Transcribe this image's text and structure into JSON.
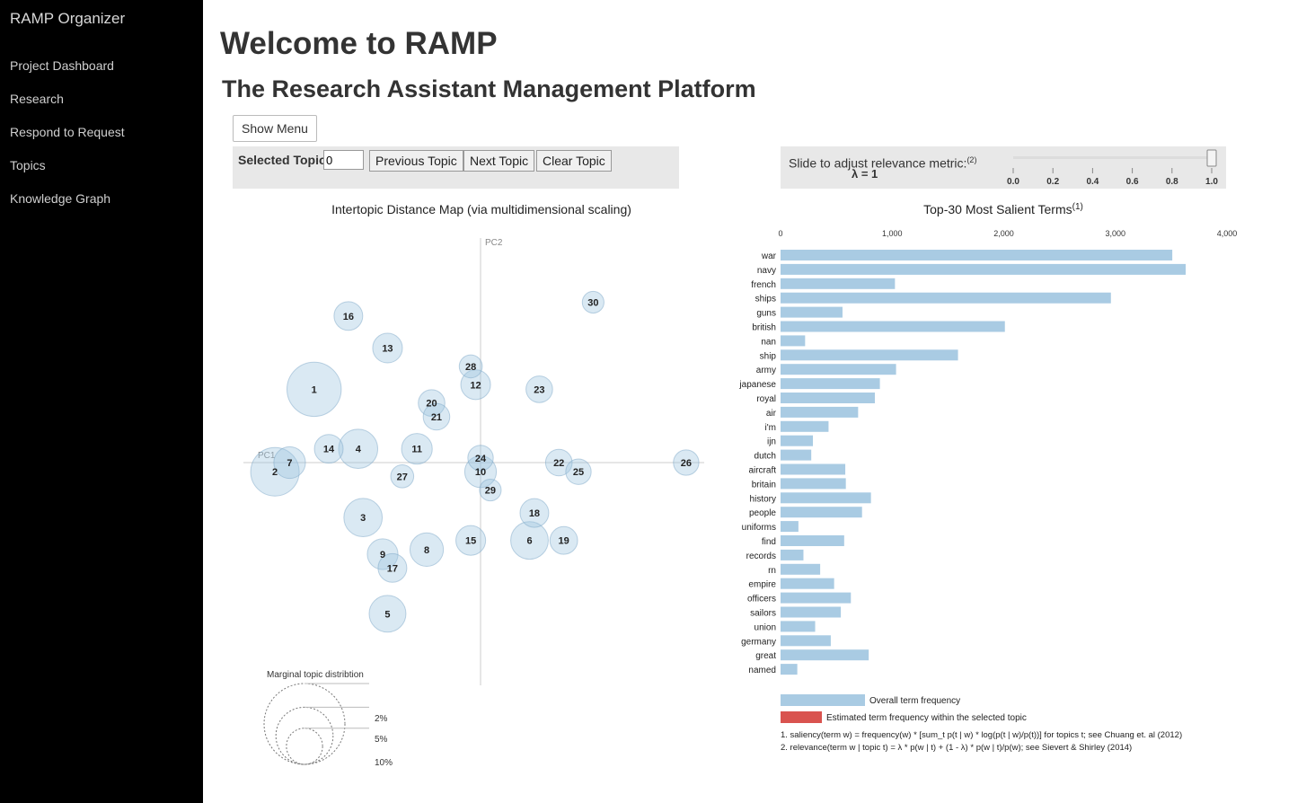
{
  "sidebar": {
    "brand": "RAMP Organizer",
    "items": [
      {
        "label": "Project Dashboard"
      },
      {
        "label": "Research"
      },
      {
        "label": "Respond to Request"
      },
      {
        "label": "Topics"
      },
      {
        "label": "Knowledge Graph"
      }
    ]
  },
  "header": {
    "title": "Welcome to RAMP",
    "subtitle": "The Research Assistant Management Platform"
  },
  "toolbar": {
    "show_menu_label": "Show Menu",
    "selected_topic_label": "Selected Topic:",
    "selected_topic_value": "0",
    "previous_label": "Previous Topic",
    "next_label": "Next Topic",
    "clear_label": "Clear Topic"
  },
  "relevance": {
    "label": "Slide to adjust relevance metric:",
    "note_marker": "(2)",
    "lambda_text": "λ = 1",
    "lambda": 1.0,
    "ticks": [
      "0.0",
      "0.2",
      "0.4",
      "0.6",
      "0.8",
      "1.0"
    ]
  },
  "chart_data": [
    {
      "type": "scatter",
      "title": "Intertopic Distance Map (via multidimensional scaling)",
      "xlabel": "PC1",
      "ylabel": "PC2",
      "colors": {
        "bubble": "#9ec4e0",
        "bubble_stroke": "#7ea8c8"
      },
      "topics": [
        {
          "id": "1",
          "x": -0.34,
          "y": 0.16,
          "size": 5.0
        },
        {
          "id": "2",
          "x": -0.42,
          "y": -0.02,
          "size": 4.0
        },
        {
          "id": "3",
          "x": -0.24,
          "y": -0.12,
          "size": 2.5
        },
        {
          "id": "4",
          "x": -0.25,
          "y": 0.03,
          "size": 2.6
        },
        {
          "id": "5",
          "x": -0.19,
          "y": -0.33,
          "size": 2.3
        },
        {
          "id": "6",
          "x": 0.1,
          "y": -0.17,
          "size": 2.4
        },
        {
          "id": "7",
          "x": -0.39,
          "y": 0.0,
          "size": 1.7
        },
        {
          "id": "8",
          "x": -0.11,
          "y": -0.19,
          "size": 1.9
        },
        {
          "id": "9",
          "x": -0.2,
          "y": -0.2,
          "size": 1.6
        },
        {
          "id": "10",
          "x": 0.0,
          "y": -0.02,
          "size": 1.7
        },
        {
          "id": "11",
          "x": -0.13,
          "y": 0.03,
          "size": 1.6
        },
        {
          "id": "12",
          "x": -0.01,
          "y": 0.17,
          "size": 1.5
        },
        {
          "id": "13",
          "x": -0.19,
          "y": 0.25,
          "size": 1.5
        },
        {
          "id": "14",
          "x": -0.31,
          "y": 0.03,
          "size": 1.4
        },
        {
          "id": "15",
          "x": -0.02,
          "y": -0.17,
          "size": 1.5
        },
        {
          "id": "16",
          "x": -0.27,
          "y": 0.32,
          "size": 1.4
        },
        {
          "id": "17",
          "x": -0.18,
          "y": -0.23,
          "size": 1.4
        },
        {
          "id": "18",
          "x": 0.11,
          "y": -0.11,
          "size": 1.4
        },
        {
          "id": "19",
          "x": 0.17,
          "y": -0.17,
          "size": 1.3
        },
        {
          "id": "20",
          "x": -0.1,
          "y": 0.13,
          "size": 1.2
        },
        {
          "id": "21",
          "x": -0.09,
          "y": 0.1,
          "size": 1.2
        },
        {
          "id": "22",
          "x": 0.16,
          "y": 0.0,
          "size": 1.2
        },
        {
          "id": "23",
          "x": 0.12,
          "y": 0.16,
          "size": 1.2
        },
        {
          "id": "24",
          "x": 0.0,
          "y": 0.01,
          "size": 1.1
        },
        {
          "id": "25",
          "x": 0.2,
          "y": -0.02,
          "size": 1.1
        },
        {
          "id": "26",
          "x": 0.42,
          "y": 0.0,
          "size": 1.1
        },
        {
          "id": "27",
          "x": -0.16,
          "y": -0.03,
          "size": 0.9
        },
        {
          "id": "28",
          "x": -0.02,
          "y": 0.21,
          "size": 0.9
        },
        {
          "id": "29",
          "x": 0.02,
          "y": -0.06,
          "size": 0.8
        },
        {
          "id": "30",
          "x": 0.23,
          "y": 0.35,
          "size": 0.8
        }
      ],
      "size_legend": {
        "title": "Marginal topic distribtion",
        "labels": [
          "2%",
          "5%",
          "10%"
        ],
        "values": [
          2,
          5,
          10
        ]
      }
    },
    {
      "type": "bar",
      "title": "Top-30 Most Salient Terms",
      "title_note": "(1)",
      "xlim": [
        0,
        4000
      ],
      "ticks": [
        "0",
        "1,000",
        "2,000",
        "3,000",
        "4,000"
      ],
      "tick_values": [
        0,
        1000,
        2000,
        3000,
        4000
      ],
      "categories": [
        "war",
        "navy",
        "french",
        "ships",
        "guns",
        "british",
        "nan",
        "ship",
        "army",
        "japanese",
        "royal",
        "air",
        "i'm",
        "ijn",
        "dutch",
        "aircraft",
        "britain",
        "history",
        "people",
        "uniforms",
        "find",
        "records",
        "rn",
        "empire",
        "officers",
        "sailors",
        "union",
        "germany",
        "great",
        "named"
      ],
      "series": [
        {
          "name": "Overall term frequency",
          "color": "#a9cbe3",
          "values": [
            3510,
            3630,
            1025,
            2960,
            555,
            2010,
            220,
            1590,
            1035,
            890,
            845,
            695,
            430,
            290,
            275,
            580,
            585,
            810,
            730,
            160,
            570,
            205,
            355,
            480,
            630,
            540,
            310,
            450,
            790,
            150
          ]
        }
      ],
      "legend": [
        {
          "label": "Overall term frequency",
          "color": "#a9cbe3"
        },
        {
          "label": "Estimated term frequency within the selected topic",
          "color": "#d9534f"
        }
      ],
      "footnotes": [
        "1. saliency(term w) = frequency(w) * [sum_t p(t | w) * log(p(t | w)/p(t))] for topics t; see Chuang et. al (2012)",
        "2. relevance(term w | topic t) = λ * p(w | t) + (1 - λ) * p(w | t)/p(w); see Sievert & Shirley (2014)"
      ]
    }
  ]
}
